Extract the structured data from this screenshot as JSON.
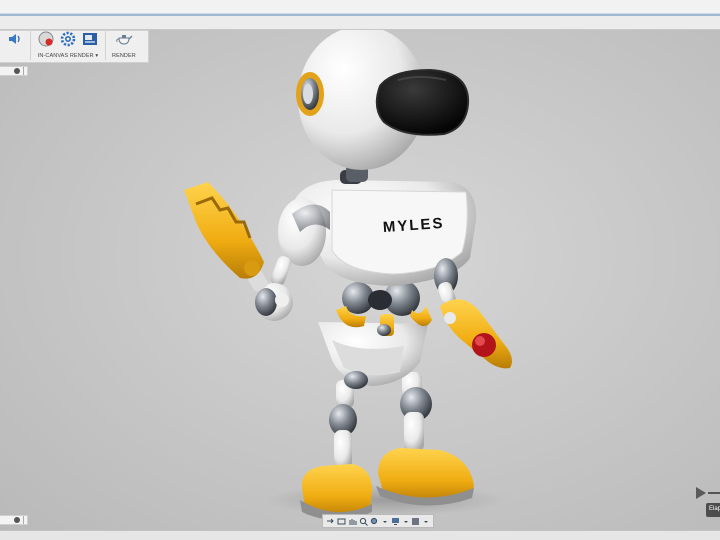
{
  "ribbon": {
    "groups": [
      {
        "label": "",
        "icons": [
          "speaker-icon"
        ]
      },
      {
        "label": "IN-CANVAS RENDER",
        "has_dropdown": true,
        "icons": [
          "in-canvas-render-icon",
          "render-settings-gear-icon",
          "render-gallery-icon"
        ]
      },
      {
        "label": "RENDER",
        "icons": [
          "render-teapot-icon"
        ]
      }
    ]
  },
  "model": {
    "chest_text": "MYLES"
  },
  "timeline": {
    "tooltip_text": "Elap"
  },
  "colors": {
    "accent_yellow": "#f2b318",
    "body_white": "#f4f4f4",
    "chrome": "#8a8f98",
    "visor": "#0c0c0c",
    "red_joint": "#b3141a"
  }
}
